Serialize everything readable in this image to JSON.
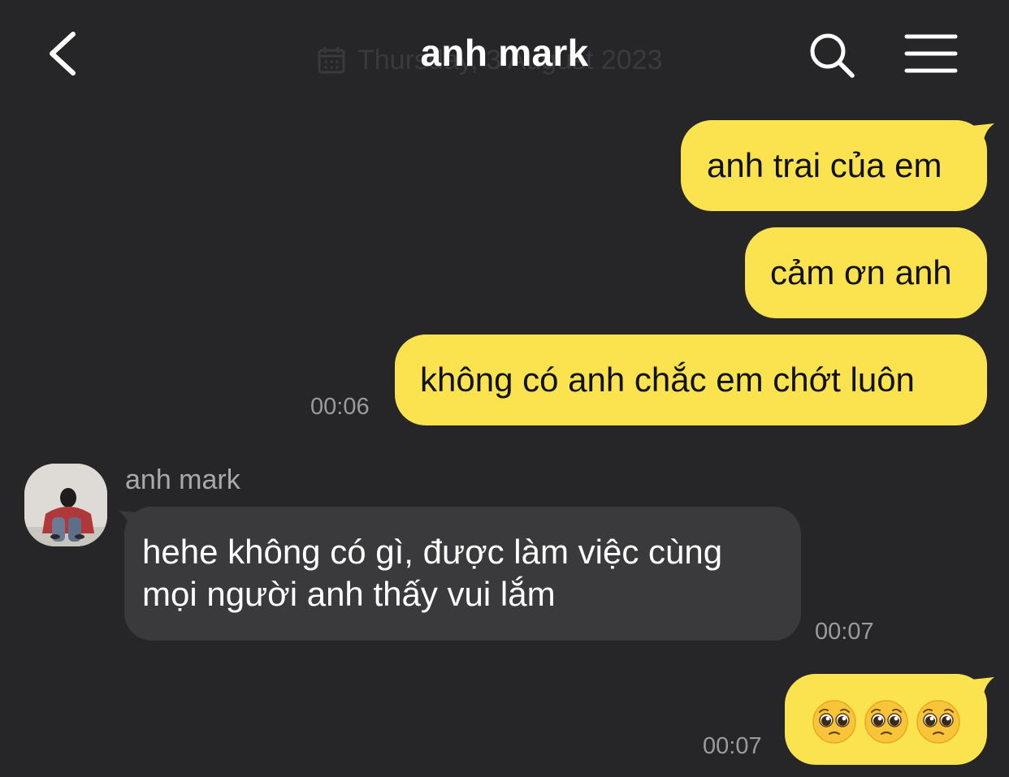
{
  "header": {
    "title": "anh mark",
    "date_overlay": "Thursday, 3 August 2023"
  },
  "messages": [
    {
      "direction": "out",
      "text": "anh trai của em"
    },
    {
      "direction": "out",
      "text": "cảm ơn anh"
    },
    {
      "direction": "out",
      "text": "không có anh chắc em chớt luôn",
      "time": "00:06"
    },
    {
      "direction": "in",
      "sender": "anh mark",
      "lines": [
        "hehe không có gì, được làm việc cùng",
        "mọi người anh thấy vui lắm"
      ],
      "time": "00:07"
    },
    {
      "direction": "out",
      "emoji_name": "pleading-face",
      "emoji_count": 3,
      "time": "00:07"
    }
  ],
  "colors": {
    "background": "#262628",
    "outgoing_bubble": "#fae34f",
    "incoming_bubble": "#3a3a3c",
    "timestamp": "#9b9b9f"
  }
}
